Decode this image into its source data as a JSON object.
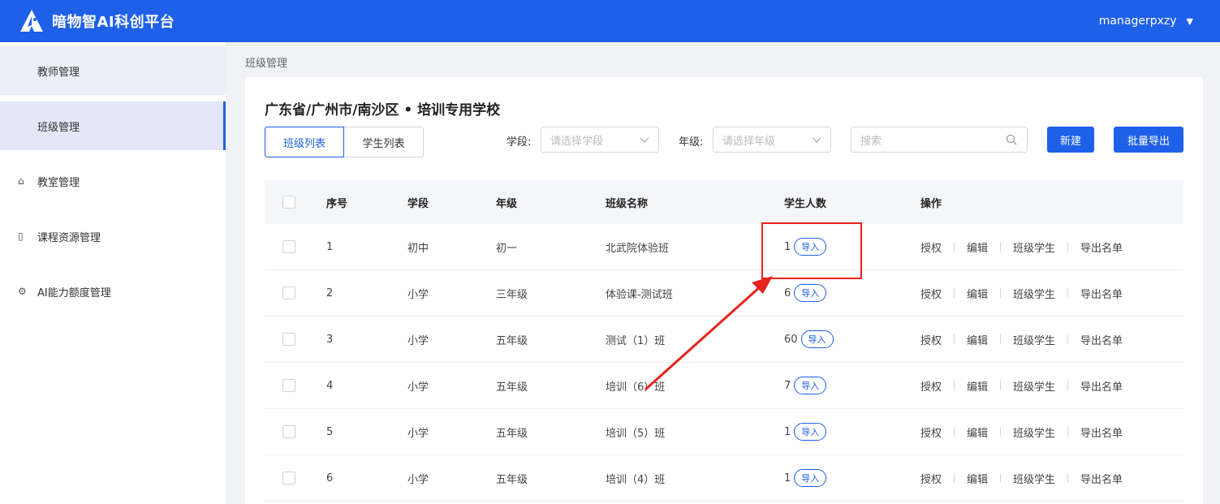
{
  "app": {
    "title": "暗物智AI科创平台",
    "user": "managerpxzy"
  },
  "sidebar": {
    "items": [
      {
        "label": "教师管理",
        "icon": "none"
      },
      {
        "label": "班级管理",
        "icon": "none"
      },
      {
        "label": "教室管理",
        "icon": "home-icon"
      },
      {
        "label": "课程资源管理",
        "icon": "book-icon"
      },
      {
        "label": "AI能力额度管理",
        "icon": "gear-icon"
      }
    ]
  },
  "breadcrumb": "班级管理",
  "school": "广东省/广州市/南沙区 • 培训专用学校",
  "tabs": {
    "class_list": "班级列表",
    "student_list": "学生列表"
  },
  "filters": {
    "stage_label": "学段:",
    "stage_placeholder": "请选择学段",
    "grade_label": "年级:",
    "grade_placeholder": "请选择年级",
    "search_placeholder": "搜索"
  },
  "buttons": {
    "new": "新建",
    "batch_export": "批量导出"
  },
  "table": {
    "headers": {
      "no": "序号",
      "stage": "学段",
      "grade": "年级",
      "name": "班级名称",
      "count": "学生人数",
      "ops": "操作"
    },
    "rows": [
      {
        "no": "1",
        "stage": "初中",
        "grade": "初一",
        "name": "北武院体验班",
        "count": "1"
      },
      {
        "no": "2",
        "stage": "小学",
        "grade": "三年级",
        "name": "体验课-测试班",
        "count": "6"
      },
      {
        "no": "3",
        "stage": "小学",
        "grade": "五年级",
        "name": "测试（1）班",
        "count": "60"
      },
      {
        "no": "4",
        "stage": "小学",
        "grade": "五年级",
        "name": "培训（6）班",
        "count": "7"
      },
      {
        "no": "5",
        "stage": "小学",
        "grade": "五年级",
        "name": "培训（5）班",
        "count": "1"
      },
      {
        "no": "6",
        "stage": "小学",
        "grade": "五年级",
        "name": "培训（4）班",
        "count": "1"
      }
    ],
    "import_label": "导入",
    "ops": {
      "authorize": "授权",
      "edit": "编辑",
      "class_students": "班级学生",
      "export_list": "导出名单"
    }
  },
  "colors": {
    "primary": "#1e60e8",
    "highlight": "#e8221d"
  }
}
